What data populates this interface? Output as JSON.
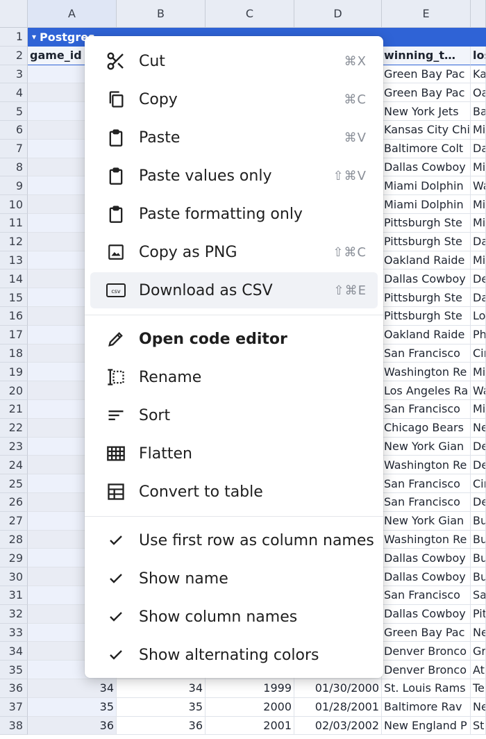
{
  "columns": [
    "A",
    "B",
    "C",
    "D",
    "E"
  ],
  "row1_title": "Postgres",
  "header_row": {
    "a": "game_id",
    "e": "winning_t…",
    "f": "los"
  },
  "rows": [
    {
      "n": "3",
      "e": "Green Bay Pac",
      "f": "Ka"
    },
    {
      "n": "4",
      "e": "Green Bay Pac",
      "f": "Oa"
    },
    {
      "n": "5",
      "e": "New York Jets",
      "f": "Ba"
    },
    {
      "n": "6",
      "e": "Kansas City Chi",
      "f": "Mi"
    },
    {
      "n": "7",
      "e": "Baltimore Colt",
      "f": "Da"
    },
    {
      "n": "8",
      "e": "Dallas Cowboy",
      "f": "Mi"
    },
    {
      "n": "9",
      "e": "Miami Dolphin",
      "f": "Wa"
    },
    {
      "n": "10",
      "e": "Miami Dolphin",
      "f": "Mi"
    },
    {
      "n": "11",
      "e": "Pittsburgh Ste",
      "f": "Mi"
    },
    {
      "n": "12",
      "e": "Pittsburgh Ste",
      "f": "Da"
    },
    {
      "n": "13",
      "e": "Oakland Raide",
      "f": "Mi"
    },
    {
      "n": "14",
      "e": "Dallas Cowboy",
      "f": "De"
    },
    {
      "n": "15",
      "e": "Pittsburgh Ste",
      "f": "Da"
    },
    {
      "n": "16",
      "e": "Pittsburgh Ste",
      "f": "Lo"
    },
    {
      "n": "17",
      "e": "Oakland Raide",
      "f": "Ph"
    },
    {
      "n": "18",
      "e": "San Francisco",
      "f": "Cir"
    },
    {
      "n": "19",
      "e": "Washington Re",
      "f": "Mi"
    },
    {
      "n": "20",
      "e": "Los Angeles Ra",
      "f": "Wa"
    },
    {
      "n": "21",
      "e": "San Francisco",
      "f": "Mi"
    },
    {
      "n": "22",
      "e": "Chicago Bears",
      "f": "Ne"
    },
    {
      "n": "23",
      "e": "New York Gian",
      "f": "De"
    },
    {
      "n": "24",
      "e": "Washington Re",
      "f": "De"
    },
    {
      "n": "25",
      "e": "San Francisco",
      "f": "Cir"
    },
    {
      "n": "26",
      "e": "San Francisco",
      "f": "De"
    },
    {
      "n": "27",
      "e": "New York Gian",
      "f": "Bu"
    },
    {
      "n": "28",
      "e": "Washington Re",
      "f": "Bu"
    },
    {
      "n": "29",
      "e": "Dallas Cowboy",
      "f": "Bu"
    },
    {
      "n": "30",
      "e": "Dallas Cowboy",
      "f": "Bu"
    },
    {
      "n": "31",
      "e": "San Francisco",
      "f": "Sa"
    },
    {
      "n": "32",
      "e": "Dallas Cowboy",
      "f": "Pit"
    },
    {
      "n": "33",
      "e": "Green Bay Pac",
      "f": "Ne"
    },
    {
      "n": "34",
      "e": "Denver Bronco",
      "f": "Gr"
    },
    {
      "n": "35",
      "e": "Denver Bronco",
      "f": "At"
    },
    {
      "n": "36",
      "a": "34",
      "b": "34",
      "c": "1999",
      "d": "01/30/2000",
      "e": "St. Louis Rams",
      "f": "Te"
    },
    {
      "n": "37",
      "a": "35",
      "b": "35",
      "c": "2000",
      "d": "01/28/2001",
      "e": "Baltimore Rav",
      "f": "Ne"
    },
    {
      "n": "38",
      "a": "36",
      "b": "36",
      "c": "2001",
      "d": "02/03/2002",
      "e": "New England P",
      "f": "St."
    }
  ],
  "menu": {
    "cut": {
      "label": "Cut",
      "shortcut": "⌘X"
    },
    "copy": {
      "label": "Copy",
      "shortcut": "⌘C"
    },
    "paste": {
      "label": "Paste",
      "shortcut": "⌘V"
    },
    "paste_values": {
      "label": "Paste values only",
      "shortcut": "⇧⌘V"
    },
    "paste_formatting": {
      "label": "Paste formatting only",
      "shortcut": ""
    },
    "copy_png": {
      "label": "Copy as PNG",
      "shortcut": "⇧⌘C"
    },
    "download_csv": {
      "label": "Download as CSV",
      "shortcut": "⇧⌘E"
    },
    "open_code_editor": {
      "label": "Open code editor"
    },
    "rename": {
      "label": "Rename"
    },
    "sort": {
      "label": "Sort"
    },
    "flatten": {
      "label": "Flatten"
    },
    "convert_table": {
      "label": "Convert to table"
    },
    "first_row_names": {
      "label": "Use first row as column names"
    },
    "show_name": {
      "label": "Show name"
    },
    "show_column_names": {
      "label": "Show column names"
    },
    "show_alternating": {
      "label": "Show alternating colors"
    }
  },
  "colors": {
    "accent": "#2f63d6",
    "header_bg": "#e8ecf4"
  }
}
